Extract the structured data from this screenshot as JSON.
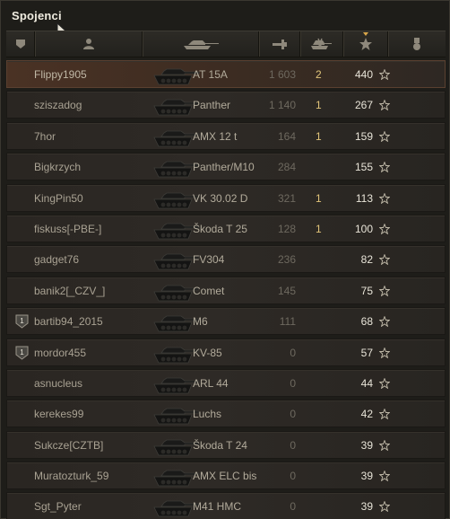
{
  "window": {
    "title": "Spojenci"
  },
  "header": {
    "columns": [
      {
        "icon": "squad-icon"
      },
      {
        "icon": "player-icon"
      },
      {
        "icon": "tank-icon"
      },
      {
        "icon": "damage-icon"
      },
      {
        "icon": "kills-icon"
      },
      {
        "icon": "star-icon"
      },
      {
        "icon": "medal-icon"
      }
    ],
    "sorted_column": "star-icon"
  },
  "rows": [
    {
      "player": "Flippy1905",
      "tank": "AT 15A",
      "damage": "1 603",
      "kills": "2",
      "xp": "440",
      "self": true,
      "badge": ""
    },
    {
      "player": "sziszadog",
      "tank": "Panther",
      "damage": "1 140",
      "kills": "1",
      "xp": "267",
      "self": false,
      "badge": ""
    },
    {
      "player": "7hor",
      "tank": "AMX 12 t",
      "damage": "164",
      "kills": "1",
      "xp": "159",
      "self": false,
      "badge": ""
    },
    {
      "player": "Bigkrzych",
      "tank": "Panther/M10",
      "damage": "284",
      "kills": "",
      "xp": "155",
      "self": false,
      "badge": ""
    },
    {
      "player": "KingPin50",
      "tank": "VK 30.02 D",
      "damage": "321",
      "kills": "1",
      "xp": "113",
      "self": false,
      "badge": ""
    },
    {
      "player": "fiskuss[-PBE-]",
      "tank": "Škoda T 25",
      "damage": "128",
      "kills": "1",
      "xp": "100",
      "self": false,
      "badge": ""
    },
    {
      "player": "gadget76",
      "tank": "FV304",
      "damage": "236",
      "kills": "",
      "xp": "82",
      "self": false,
      "badge": ""
    },
    {
      "player": "banik2[_CZV_]",
      "tank": "Comet",
      "damage": "145",
      "kills": "",
      "xp": "75",
      "self": false,
      "badge": ""
    },
    {
      "player": "bartib94_2015",
      "tank": "M6",
      "damage": "111",
      "kills": "",
      "xp": "68",
      "self": false,
      "badge": "1"
    },
    {
      "player": "mordor455",
      "tank": "KV-85",
      "damage": "0",
      "kills": "",
      "xp": "57",
      "self": false,
      "badge": "1"
    },
    {
      "player": "asnucleus",
      "tank": "ARL 44",
      "damage": "0",
      "kills": "",
      "xp": "44",
      "self": false,
      "badge": ""
    },
    {
      "player": "kerekes99",
      "tank": "Luchs",
      "damage": "0",
      "kills": "",
      "xp": "42",
      "self": false,
      "badge": ""
    },
    {
      "player": "Sukcze[CZTB]",
      "tank": "Škoda T 24",
      "damage": "0",
      "kills": "",
      "xp": "39",
      "self": false,
      "badge": ""
    },
    {
      "player": "Muratozturk_59",
      "tank": "AMX ELC bis",
      "damage": "0",
      "kills": "",
      "xp": "39",
      "self": false,
      "badge": ""
    },
    {
      "player": "Sgt_Pyter",
      "tank": "M41 HMC",
      "damage": "0",
      "kills": "",
      "xp": "39",
      "self": false,
      "badge": ""
    }
  ],
  "colors": {
    "accent": "#d9a64a",
    "self_row": "#4a3224",
    "kills": "#e0c47a"
  }
}
